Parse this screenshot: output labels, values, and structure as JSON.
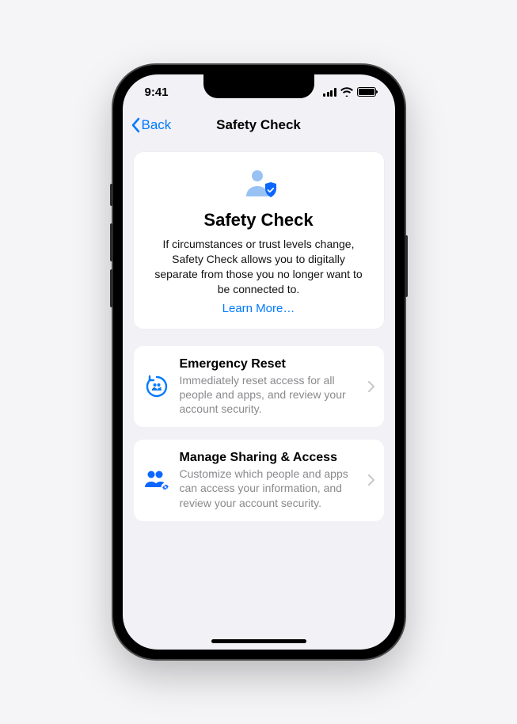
{
  "status": {
    "time": "9:41"
  },
  "nav": {
    "back_label": "Back",
    "title": "Safety Check"
  },
  "hero": {
    "title": "Safety Check",
    "description": "If circumstances or trust levels change, Safety Check allows you to digitally separate from those you no longer want to be connected to.",
    "learn_more": "Learn More…"
  },
  "options": [
    {
      "icon": "reset-circle-icon",
      "title": "Emergency Reset",
      "description": "Immediately reset access for all people and apps, and review your account security."
    },
    {
      "icon": "people-gear-icon",
      "title": "Manage Sharing & Access",
      "description": "Customize which people and apps can access your information, and review your account security."
    }
  ],
  "colors": {
    "accent": "#007aff",
    "icon_light": "#99c2f4"
  }
}
